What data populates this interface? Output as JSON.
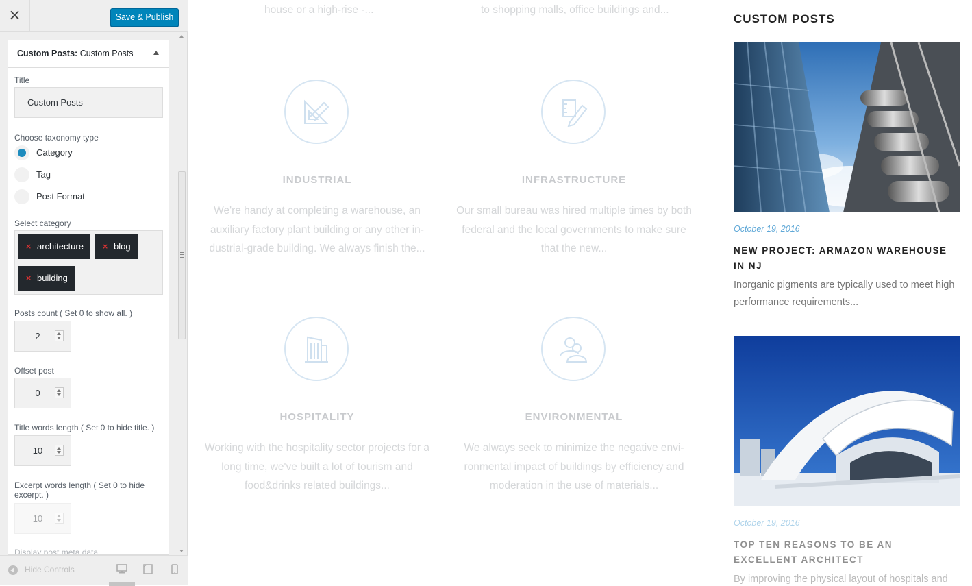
{
  "customizer": {
    "close_icon": "×",
    "publish_label": "Save & Publish",
    "section": {
      "prefix": "Custom Posts:",
      "name": "Custom Posts"
    },
    "title_label": "Title",
    "title_value": "Custom Posts",
    "taxonomy_label": "Choose taxonomy type",
    "taxonomy_options": [
      "Category",
      "Tag",
      "Post Format"
    ],
    "taxonomy_selected": "Category",
    "category_label": "Select category",
    "categories": [
      "architecture",
      "blog",
      "building"
    ],
    "tag_remove_glyph": "×",
    "posts_count_label": "Posts count ( Set 0 to show all. )",
    "posts_count": "2",
    "offset_label": "Offset post",
    "offset": "0",
    "title_words_label": "Title words length ( Set 0 to hide title. )",
    "title_words": "10",
    "excerpt_words_label": "Excerpt words length ( Set 0 to hide excerpt. )",
    "excerpt_words": "10",
    "meta_label": "Display post meta data",
    "hide_controls": "Hide Controls",
    "devices": [
      "desktop-icon",
      "tablet-icon",
      "mobile-icon"
    ]
  },
  "preview": {
    "top_fragments": [
      "house or a high-rise -...",
      "to shopping malls, office buildings and..."
    ],
    "services": [
      {
        "title": "INDUSTRIAL",
        "icon": "ruler-triangle-icon",
        "text": "We're handy at completing a warehouse, an auxiliary factory plant building or any other in-dustrial-grade building. We always finish the..."
      },
      {
        "title": "INFRASTRUCTURE",
        "icon": "pencil-blueprint-icon",
        "text": "Our small bureau was hired multiple times by both federal and the local governments to make sure that the new..."
      },
      {
        "title": "HOSPITALITY",
        "icon": "building-icon",
        "text": "Working with the hospitality sector projects for a long time, we've built a lot of tourism and food&drinks related buildings..."
      },
      {
        "title": "ENVIRONMENTAL",
        "icon": "people-icon",
        "text": "We always seek to minimize the negative envi-ronmental impact of buildings by efficiency and moderation in the use of materials..."
      }
    ],
    "widget": {
      "title": "CUSTOM POSTS",
      "posts": [
        {
          "date": "October 19, 2016",
          "title": "NEW PROJECT: ARMAZON WAREHOUSE IN NJ",
          "excerpt": "Inorganic pigments are typically used to meet high performance requirements..."
        },
        {
          "date": "October 19, 2016",
          "title": "TOP TEN REASONS TO BE AN EXCELLENT ARCHITECT",
          "excerpt": "By improving the physical layout of hospitals and"
        }
      ]
    },
    "colors": {
      "accent": "#0085ba",
      "date": "#5fa8d7",
      "icon_ring": "#d6e5f2"
    }
  }
}
